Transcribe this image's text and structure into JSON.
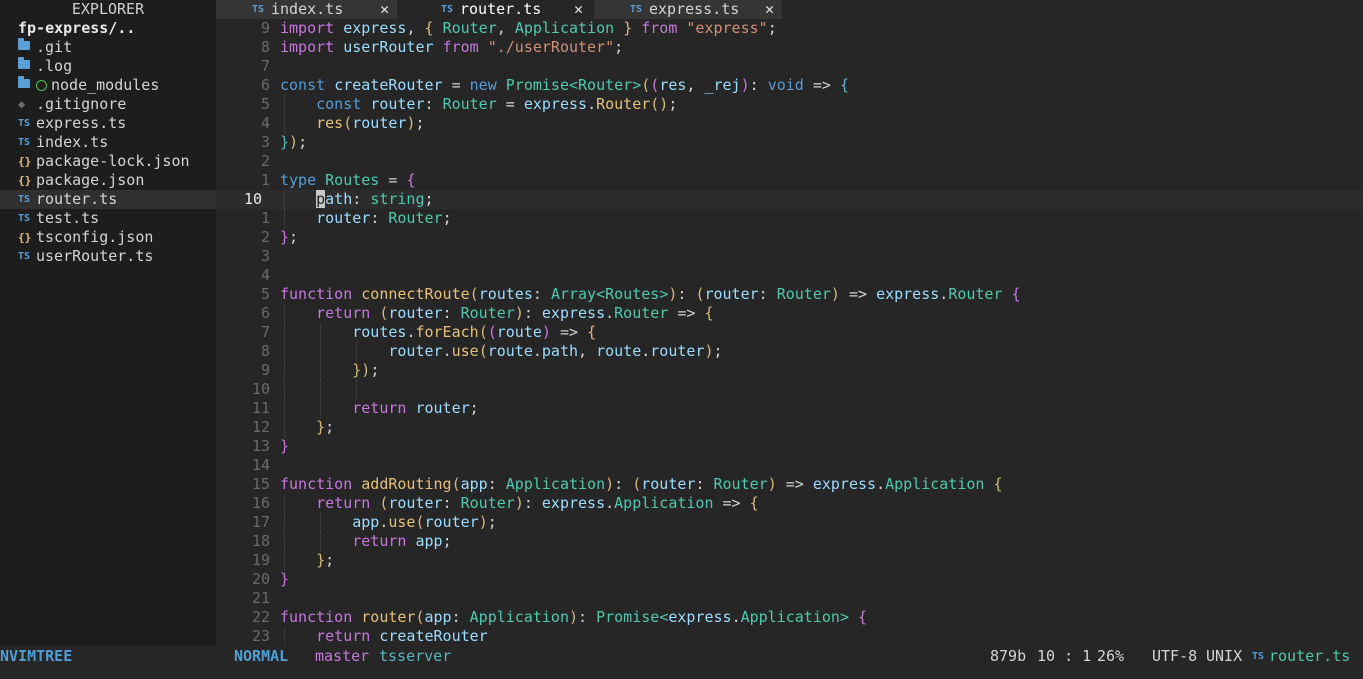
{
  "sidebar": {
    "title": "EXPLORER",
    "root": "fp-express/..",
    "items": [
      {
        "label": ".git",
        "icon": "folder-icon"
      },
      {
        "label": ".log",
        "icon": "folder-icon"
      },
      {
        "label": "node_modules",
        "icon": "folder-icon"
      },
      {
        "label": ".gitignore",
        "icon": "git-icon"
      },
      {
        "label": "express.ts",
        "icon": "ts-icon"
      },
      {
        "label": "index.ts",
        "icon": "ts-icon"
      },
      {
        "label": "package-lock.json",
        "icon": "json-icon"
      },
      {
        "label": "package.json",
        "icon": "json-icon"
      },
      {
        "label": "router.ts",
        "icon": "ts-icon",
        "selected": true
      },
      {
        "label": "test.ts",
        "icon": "ts-icon"
      },
      {
        "label": "tsconfig.json",
        "icon": "json-icon"
      },
      {
        "label": "userRouter.ts",
        "icon": "ts-icon"
      }
    ],
    "ts_glyph": "TS",
    "json_glyph": "{}",
    "git_glyph": "◆"
  },
  "tabs": [
    {
      "label": "index.ts",
      "close": "✕",
      "active": false
    },
    {
      "label": "router.ts",
      "close": "✕",
      "active": true
    },
    {
      "label": "express.ts",
      "close": "✕",
      "active": false
    }
  ],
  "editor": {
    "line_numbers": [
      "9",
      "8",
      "7",
      "6",
      "5",
      "4",
      "3",
      "2",
      "1",
      "10",
      "1",
      "2",
      "3",
      "4",
      "5",
      "6",
      "7",
      "8",
      "9",
      "10",
      "11",
      "12",
      "13",
      "14",
      "15",
      "16",
      "17",
      "18",
      "19",
      "20",
      "21",
      "22",
      "23"
    ],
    "current_line_number": "10",
    "cursor_char": "p"
  },
  "statusbar": {
    "tree": "NVIMTREE",
    "mode": "NORMAL",
    "branch_icon": "",
    "branch": "master",
    "lsp": "tsserver",
    "size": "879b",
    "position": "10 : 1",
    "percent": "26%",
    "encoding": "UTF-8",
    "format": "UNIX",
    "filetype_icon": "TS",
    "filetype": "router.ts"
  },
  "colors": {
    "background": "#262626",
    "sidebar": "#1d1d1d",
    "keyword": "#c678dd",
    "type": "#4ec9b0",
    "function": "#e5c07b",
    "string": "#ce9178",
    "accent": "#4f9ed6"
  }
}
